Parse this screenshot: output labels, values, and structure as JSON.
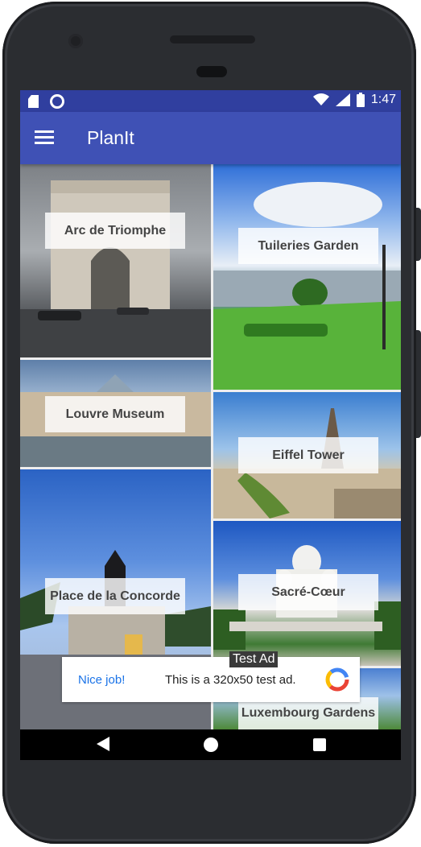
{
  "status_bar": {
    "time": "1:47"
  },
  "app_bar": {
    "title": "PlanIt"
  },
  "places": [
    {
      "label": "Arc de Triomphe"
    },
    {
      "label": "Louvre Museum"
    },
    {
      "label": "Place de la Concorde"
    },
    {
      "label": "Tuileries Garden"
    },
    {
      "label": "Eiffel Tower"
    },
    {
      "label": "Sacré-Cœur"
    },
    {
      "label": "Luxembourg Gardens"
    }
  ],
  "ad": {
    "badge": "Test Ad",
    "cta": "Nice job!",
    "text": "This is a 320x50 test ad.",
    "logo_text": "Google"
  },
  "colors": {
    "status_bar": "#303f9f",
    "app_bar": "#3f51b5",
    "ad_link": "#1a73e8"
  },
  "icons": {
    "status": [
      "sd-card-icon",
      "sync-ring-icon",
      "wifi-icon",
      "signal-icon",
      "battery-icon"
    ],
    "nav": [
      "back-icon",
      "home-icon",
      "recents-icon"
    ]
  }
}
